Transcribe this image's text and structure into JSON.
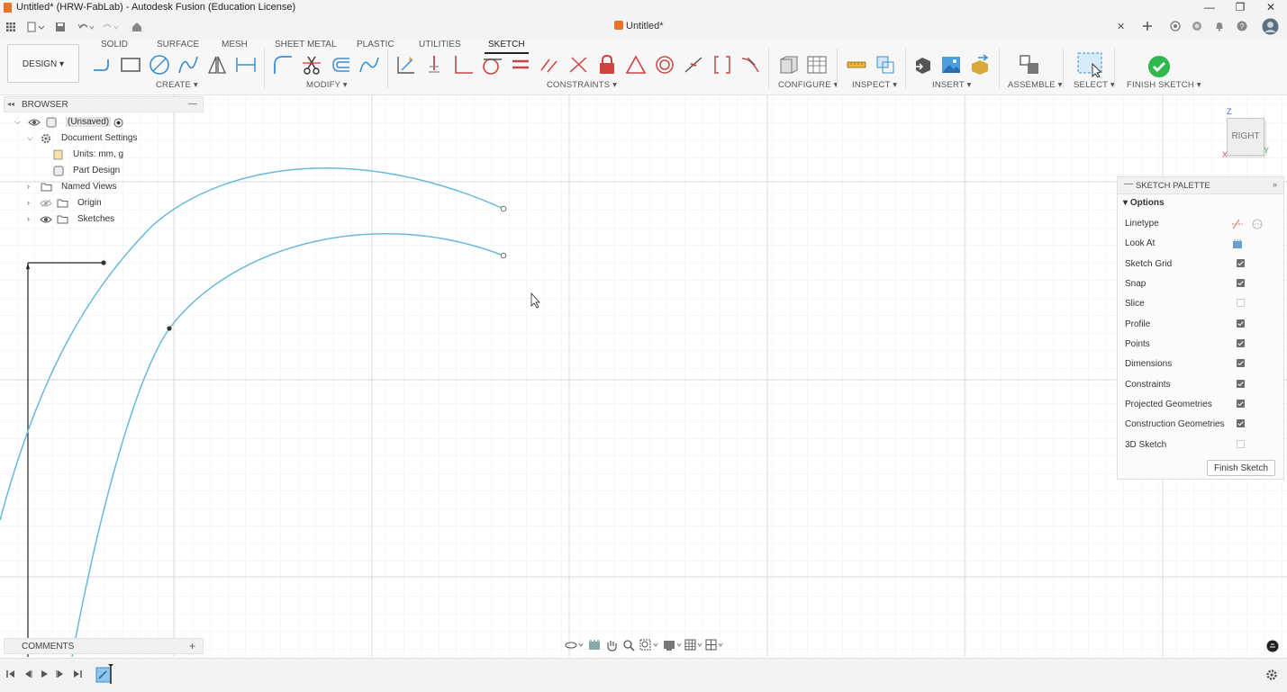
{
  "window": {
    "title": "Untitled* (HRW-FabLab) - Autodesk Fusion (Education License)",
    "controls": {
      "minimize": "—",
      "maximize": "❐",
      "close": "✕"
    }
  },
  "document_tab": {
    "label": "Untitled*",
    "close": "✕"
  },
  "workspace_tabs": [
    "SOLID",
    "SURFACE",
    "MESH",
    "SHEET METAL",
    "PLASTIC",
    "UTILITIES",
    "SKETCH"
  ],
  "active_workspace_tab": "SKETCH",
  "design_button": "DESIGN ▾",
  "toolbar_groups": {
    "create": "CREATE ▾",
    "modify": "MODIFY ▾",
    "constraints": "CONSTRAINTS ▾",
    "configure": "CONFIGURE ▾",
    "inspect": "INSPECT ▾",
    "insert": "INSERT ▾",
    "assemble": "ASSEMBLE ▾",
    "select": "SELECT ▾",
    "finish_sketch": "FINISH SKETCH ▾"
  },
  "browser": {
    "title": "BROWSER",
    "collapse": "◂◂",
    "minimize": "—",
    "items": [
      {
        "label": "(Unsaved)"
      },
      {
        "label": "Document Settings"
      },
      {
        "label": "Units: mm, g"
      },
      {
        "label": "Part Design"
      },
      {
        "label": "Named Views"
      },
      {
        "label": "Origin"
      },
      {
        "label": "Sketches"
      }
    ]
  },
  "viewcube": {
    "face": "RIGHT",
    "axis_z": "Z",
    "axis_x": "X",
    "axis_y": "Y"
  },
  "sketch_palette": {
    "title": "SKETCH PALETTE",
    "section": "Options",
    "rows": [
      {
        "label": "Linetype"
      },
      {
        "label": "Look At"
      },
      {
        "label": "Sketch Grid",
        "checked": true
      },
      {
        "label": "Snap",
        "checked": true
      },
      {
        "label": "Slice",
        "checked": false
      },
      {
        "label": "Profile",
        "checked": true
      },
      {
        "label": "Points",
        "checked": true
      },
      {
        "label": "Dimensions",
        "checked": true
      },
      {
        "label": "Constraints",
        "checked": true
      },
      {
        "label": "Projected Geometries",
        "checked": true
      },
      {
        "label": "Construction Geometries",
        "checked": true
      },
      {
        "label": "3D Sketch",
        "checked": false
      }
    ],
    "finish_button": "Finish Sketch"
  },
  "comments": {
    "title": "COMMENTS",
    "add": "+"
  },
  "colors": {
    "sketch_curve": "#6ab8dc",
    "grid_minor": "#ececec",
    "grid_major": "#d8d8d8",
    "finish_green": "#2eb84d",
    "accent_orange": "#e8742b"
  }
}
